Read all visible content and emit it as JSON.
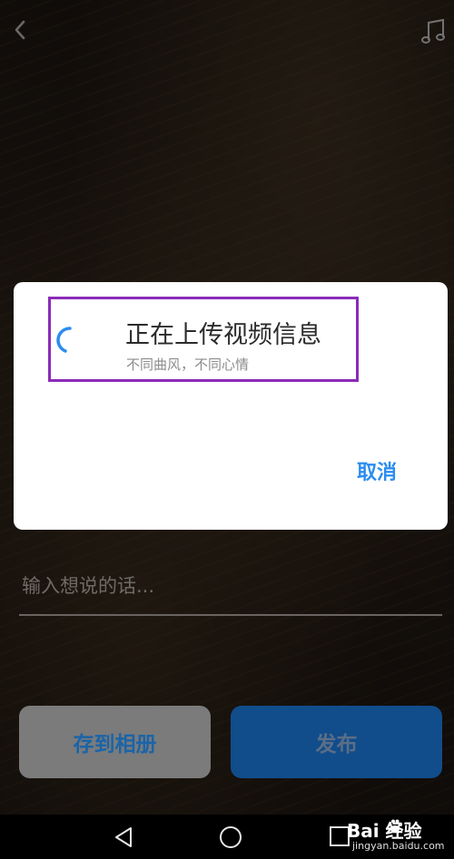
{
  "top_bar": {
    "back_icon": "chevron-left-icon",
    "music_icon": "music-note-icon"
  },
  "caption": {
    "placeholder": "输入想说的话..."
  },
  "actions": {
    "save_label": "存到相册",
    "publish_label": "发布"
  },
  "dialog": {
    "title": "正在上传视频信息",
    "subtitle": "不同曲风，不同心情",
    "cancel_label": "取消",
    "spinner_icon": "loading-spinner-icon"
  },
  "nav_bar": {
    "back_icon": "triangle-back-icon",
    "home_icon": "circle-home-icon",
    "recent_icon": "square-recent-icon"
  },
  "watermark": {
    "brand": "Bai  经验",
    "url": "jingyan.baidu.com"
  },
  "colors": {
    "accent": "#2a8df0",
    "highlight": "#8a2bb8",
    "publish_bg": "#114d8b",
    "save_bg": "#7b7b7b"
  }
}
